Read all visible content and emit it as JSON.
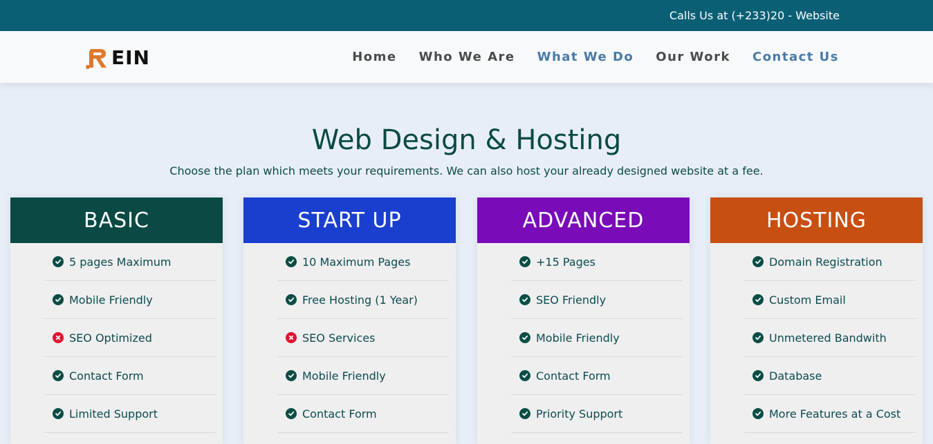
{
  "topbar": {
    "text": "Calls Us at (+233)20 - Website"
  },
  "brand": {
    "logo_text": "EIN",
    "logo_letter": "R",
    "accent": "#e0782a"
  },
  "nav": {
    "items": [
      {
        "label": "Home",
        "accent": false
      },
      {
        "label": "Who We Are",
        "accent": false
      },
      {
        "label": "What We Do",
        "accent": true
      },
      {
        "label": "Our Work",
        "accent": false
      },
      {
        "label": "Contact Us",
        "accent": true
      }
    ]
  },
  "main": {
    "title": "Web Design & Hosting",
    "subtitle": "Choose the plan which meets your requirements. We can also host your already designed website at a fee."
  },
  "plans": [
    {
      "name": "BASIC",
      "color": "#0b4a44",
      "features": [
        {
          "text": "5 pages Maximum",
          "included": true
        },
        {
          "text": "Mobile Friendly",
          "included": true
        },
        {
          "text": "SEO Optimized",
          "included": false
        },
        {
          "text": "Contact Form",
          "included": true
        },
        {
          "text": "Limited Support",
          "included": true
        }
      ]
    },
    {
      "name": "START UP",
      "color": "#1a3fcf",
      "features": [
        {
          "text": "10 Maximum Pages",
          "included": true
        },
        {
          "text": "Free Hosting (1 Year)",
          "included": true
        },
        {
          "text": "SEO Services",
          "included": false
        },
        {
          "text": "Mobile Friendly",
          "included": true
        },
        {
          "text": "Contact Form",
          "included": true
        }
      ]
    },
    {
      "name": "ADVANCED",
      "color": "#7a0bb8",
      "features": [
        {
          "text": "+15 Pages",
          "included": true
        },
        {
          "text": "SEO Friendly",
          "included": true
        },
        {
          "text": "Mobile Friendly",
          "included": true
        },
        {
          "text": "Contact Form",
          "included": true
        },
        {
          "text": "Priority Support",
          "included": true
        }
      ]
    },
    {
      "name": "HOSTING",
      "color": "#c84f12",
      "features": [
        {
          "text": "Domain Registration",
          "included": true
        },
        {
          "text": "Custom Email",
          "included": true
        },
        {
          "text": "Unmetered Bandwith",
          "included": true
        },
        {
          "text": "Database",
          "included": true
        },
        {
          "text": "More Features at a Cost",
          "included": true
        }
      ]
    }
  ]
}
